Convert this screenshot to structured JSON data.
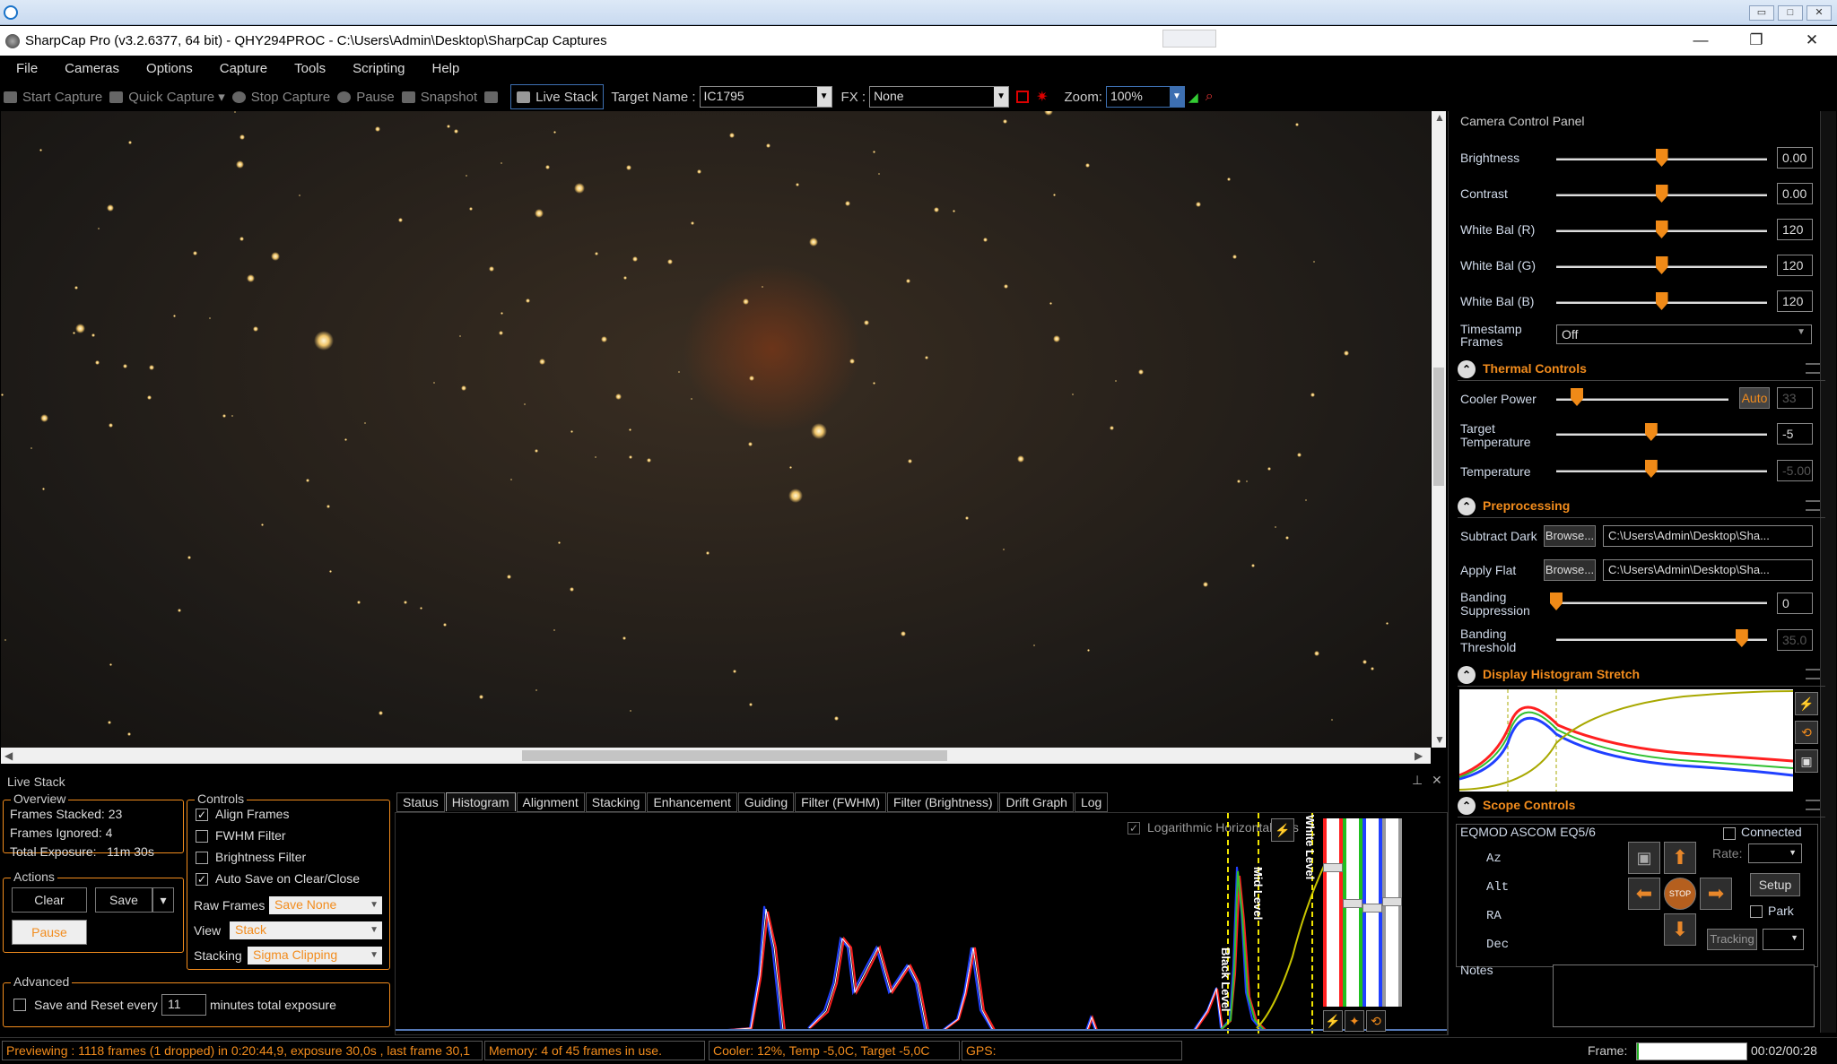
{
  "remote": {
    "ctrl_min": "▭",
    "ctrl_max": "□",
    "ctrl_close": "✕"
  },
  "title": {
    "text": "SharpCap Pro (v3.2.6377, 64 bit) - QHY294PROC - C:\\Users\\Admin\\Desktop\\SharpCap Captures",
    "min": "—",
    "max": "❐",
    "close": "✕"
  },
  "menu": [
    "File",
    "Cameras",
    "Options",
    "Capture",
    "Tools",
    "Scripting",
    "Help"
  ],
  "toolbar": {
    "start_capture": "Start Capture",
    "quick_capture": "Quick Capture",
    "stop_capture": "Stop Capture",
    "pause": "Pause",
    "snapshot": "Snapshot",
    "live_stack": "Live Stack",
    "target_label": "Target Name :",
    "target_value": "IC1795",
    "fx_label": "FX :",
    "fx_value": "None",
    "zoom_label": "Zoom:",
    "zoom_value": "100%"
  },
  "camera_panel": {
    "title": "Camera Control Panel",
    "rows": [
      {
        "label": "Brightness",
        "value": "0.00",
        "level": 0.5
      },
      {
        "label": "Contrast",
        "value": "0.00",
        "level": 0.5
      },
      {
        "label": "White Bal (R)",
        "value": "120",
        "level": 0.5
      },
      {
        "label": "White Bal (G)",
        "value": "120",
        "level": 0.5
      },
      {
        "label": "White Bal (B)",
        "value": "120",
        "level": 0.5
      }
    ],
    "timestamp_label": "Timestamp Frames",
    "timestamp_value": "Off",
    "thermal": {
      "title": "Thermal Controls",
      "cooler_label": "Cooler Power",
      "cooler_auto": "Auto",
      "cooler_value": "33",
      "cooler_level": 0.12,
      "target_label": "Target Temperature",
      "target_value": "-5",
      "target_level": 0.45,
      "temp_label": "Temperature",
      "temp_value": "-5.00",
      "temp_level": 0.45
    },
    "pre": {
      "title": "Preprocessing",
      "dark_label": "Subtract Dark",
      "browse": "Browse...",
      "dark_path": "C:\\Users\\Admin\\Desktop\\Sha...",
      "flat_label": "Apply Flat",
      "flat_path": "C:\\Users\\Admin\\Desktop\\Sha...",
      "band_sup_label": "Banding Suppression",
      "band_sup_value": "0",
      "band_sup_level": 0.0,
      "band_thr_label": "Banding Threshold",
      "band_thr_value": "35.0",
      "band_thr_level": 0.88
    },
    "stretch": {
      "title": "Display Histogram Stretch"
    },
    "scope": {
      "title": "Scope Controls",
      "mount": "EQMOD ASCOM EQ5/6",
      "connected": "Connected",
      "az": "Az",
      "alt": "Alt",
      "ra": "RA",
      "dec": "Dec",
      "rate": "Rate:",
      "setup": "Setup",
      "park": "Park",
      "tracking": "Tracking",
      "stop": "STOP"
    },
    "notes": "Notes"
  },
  "livestack": {
    "title": "Live Stack",
    "overview": {
      "legend": "Overview",
      "stacked": "Frames Stacked: 23",
      "ignored": "Frames Ignored:  4",
      "exposure": "Total Exposure:   11m 30s"
    },
    "actions": {
      "legend": "Actions",
      "clear": "Clear",
      "save": "Save",
      "pause": "Pause"
    },
    "advanced": {
      "legend": "Advanced",
      "save_reset": "Save and Reset every",
      "minutes_value": "11",
      "minutes_label": "minutes total exposure"
    },
    "controls": {
      "legend": "Controls",
      "align": "Align Frames",
      "fwhm": "FWHM Filter",
      "brightness": "Brightness Filter",
      "autosave": "Auto Save on Clear/Close",
      "raw_label": "Raw Frames",
      "raw_value": "Save None",
      "view_label": "View",
      "view_value": "Stack",
      "stacking_label": "Stacking",
      "stacking_value": "Sigma Clipping"
    },
    "tabs": [
      "Status",
      "Histogram",
      "Alignment",
      "Stacking",
      "Enhancement",
      "Guiding",
      "Filter (FWHM)",
      "Filter (Brightness)",
      "Drift Graph",
      "Log"
    ],
    "active_tab": "Histogram",
    "histogram": {
      "log_axis": "Logarithmic Horizontal Axis",
      "black": "Black Level",
      "mid": "Mid Level",
      "white": "White Level"
    }
  },
  "status": {
    "preview": "Previewing : 1118 frames (1 dropped) in 0:20:44,9, exposure 30,0s , last frame 30,1",
    "memory": "Memory: 4 of 45 frames in use.",
    "cooler": "Cooler: 12%, Temp -5,0C, Target -5,0C",
    "gps": "GPS:",
    "frame_label": "Frame:",
    "frame_progress": 0.02,
    "frame_time": "00:02/00:28"
  },
  "colors": {
    "accent": "#f28c1d",
    "red": "#ff2020",
    "green": "#20c020",
    "blue": "#2040ff",
    "white": "#ffffff",
    "yellow": "#e8e000"
  },
  "icons": [
    "remote-app-icon",
    "sharpcap-icon",
    "camera-icon",
    "stop-icon",
    "pause-icon",
    "snapshot-icon",
    "live-stack-icon",
    "zoom-icon",
    "collapse-icon",
    "menu-icon",
    "checkbox-icon",
    "arrow-up-icon",
    "arrow-down-icon",
    "arrow-left-icon",
    "arrow-right-icon"
  ]
}
